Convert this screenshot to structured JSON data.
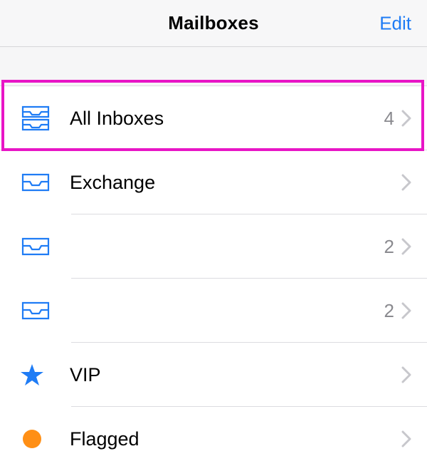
{
  "navbar": {
    "title": "Mailboxes",
    "edit": "Edit"
  },
  "rows": {
    "all_inboxes": {
      "label": "All Inboxes",
      "count": "4"
    },
    "exchange": {
      "label": "Exchange",
      "count": ""
    },
    "acct3": {
      "label": "",
      "count": "2"
    },
    "acct4": {
      "label": "",
      "count": "2"
    },
    "vip": {
      "label": "VIP",
      "count": ""
    },
    "flagged": {
      "label": "Flagged",
      "count": ""
    }
  },
  "colors": {
    "accent": "#1f7cf5",
    "highlight": "#e815c6",
    "flag_dot": "#ff8f15"
  }
}
